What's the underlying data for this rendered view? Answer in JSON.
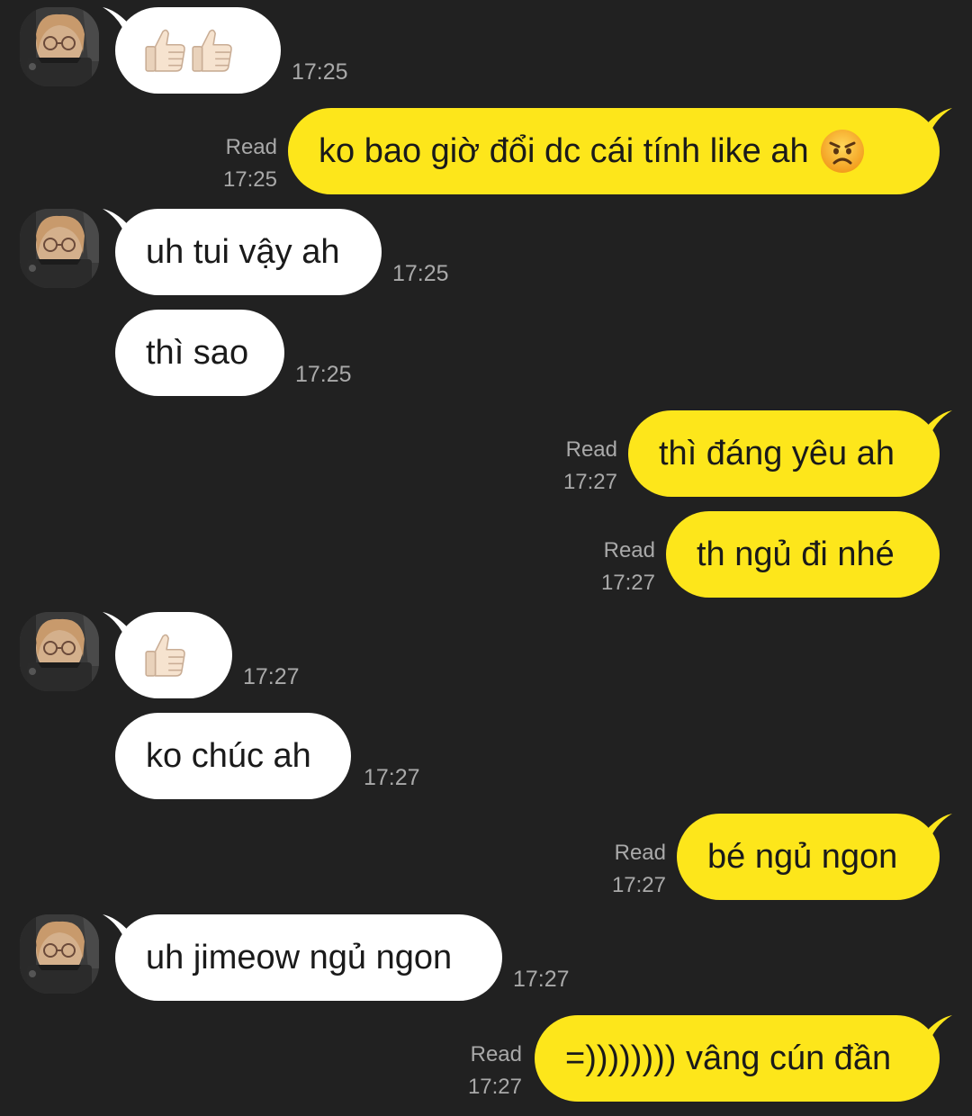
{
  "messages": [
    {
      "from": "them",
      "text": "👍🏻👍🏻",
      "time": "17:25"
    },
    {
      "from": "me",
      "text": "ko bao giờ đổi dc cái tính like ah",
      "emoji": "angry-face",
      "status": "Read",
      "time": "17:25"
    },
    {
      "from": "them",
      "text": "uh tui vậy ah",
      "time": "17:25"
    },
    {
      "from": "them",
      "text": "thì sao",
      "time": "17:25"
    },
    {
      "from": "me",
      "text": "thì đáng yêu ah",
      "status": "Read",
      "time": "17:27"
    },
    {
      "from": "me",
      "text": "th ngủ đi nhé",
      "status": "Read",
      "time": "17:27"
    },
    {
      "from": "them",
      "text": "👍🏻",
      "time": "17:27"
    },
    {
      "from": "them",
      "text": "ko chúc ah",
      "time": "17:27"
    },
    {
      "from": "me",
      "text": "bé ngủ ngon",
      "status": "Read",
      "time": "17:27"
    },
    {
      "from": "them",
      "text": "uh jimeow ngủ ngon",
      "time": "17:27"
    },
    {
      "from": "me",
      "text": "=)))))))) vâng cún đần",
      "status": "Read",
      "time": "17:27"
    }
  ],
  "colors": {
    "background": "#212121",
    "incoming_bubble": "#ffffff",
    "outgoing_bubble": "#fde61b",
    "meta_text": "#a9a9a9"
  }
}
